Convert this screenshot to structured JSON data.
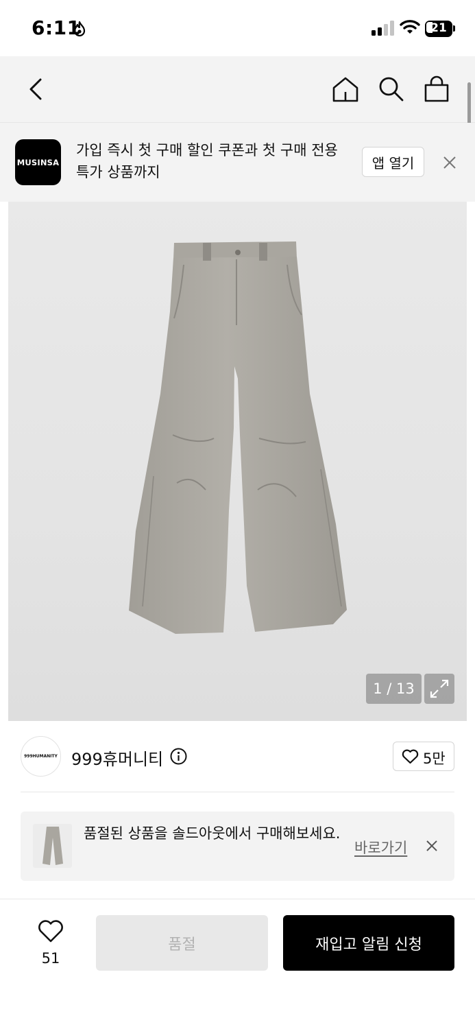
{
  "status_bar": {
    "time": "6:11",
    "battery": "21"
  },
  "icons": {
    "status": [
      "flame-icon",
      "signal-icon",
      "wifi-icon",
      "battery-icon"
    ],
    "nav": [
      "back-icon",
      "home-icon",
      "search-icon",
      "shopping-bag-icon"
    ]
  },
  "app_banner": {
    "logo_text": "MUSINSA",
    "message": "가입 즉시 첫 구매 할인 쿠폰과 첫 구매 전용 특가 상품까지",
    "open_label": "앱 열기"
  },
  "product_image": {
    "counter": "1 / 13"
  },
  "brand": {
    "logo_text": "999HUMANITY",
    "name": "999휴머니티",
    "like_count": "5만"
  },
  "notice": {
    "text": "품절된 상품을 솔드아웃에서 구매해보세요.",
    "link_label": "바로가기"
  },
  "bottom_bar": {
    "like_count": "51",
    "soldout_label": "품절",
    "restock_label": "재입고 알림 신청"
  }
}
